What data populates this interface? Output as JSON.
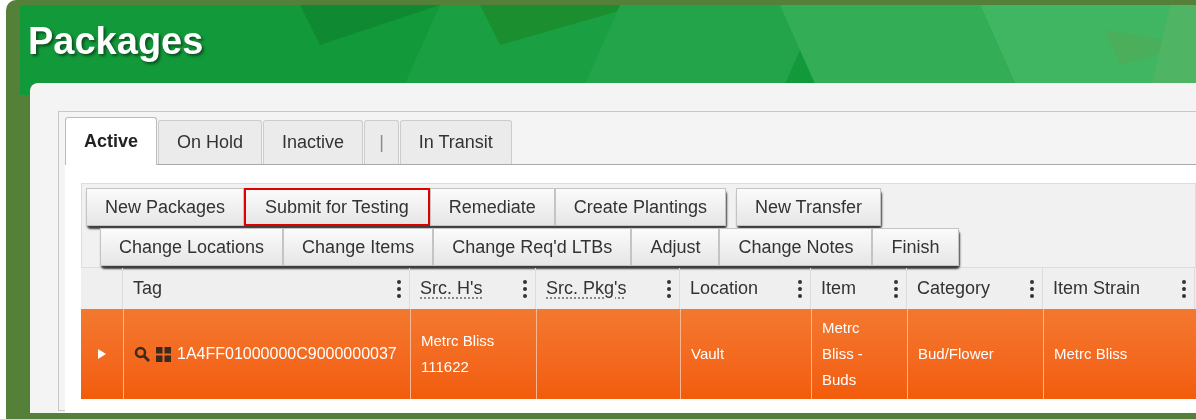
{
  "page": {
    "title": "Packages"
  },
  "tabs": [
    {
      "label": "Active",
      "kind": "tab",
      "selected": true
    },
    {
      "label": "On Hold",
      "kind": "tab",
      "selected": false
    },
    {
      "label": "Inactive",
      "kind": "tab",
      "selected": false
    },
    {
      "label": "|",
      "kind": "separator",
      "selected": false
    },
    {
      "label": "In Transit",
      "kind": "tab",
      "selected": false
    }
  ],
  "toolbar": {
    "rows": [
      {
        "groups": [
          [
            {
              "label": "New Packages",
              "highlighted": false
            },
            {
              "label": "Submit for Testing",
              "highlighted": true
            },
            {
              "label": "Remediate",
              "highlighted": false
            },
            {
              "label": "Create Plantings",
              "highlighted": false
            }
          ],
          [
            {
              "label": "New Transfer",
              "highlighted": false
            }
          ]
        ]
      },
      {
        "groups": [
          [
            {
              "label": "Change Locations",
              "highlighted": false
            },
            {
              "label": "Change Items",
              "highlighted": false
            },
            {
              "label": "Change Req'd LTBs",
              "highlighted": false
            },
            {
              "label": "Adjust",
              "highlighted": false
            },
            {
              "label": "Change Notes",
              "highlighted": false
            },
            {
              "label": "Finish",
              "highlighted": false
            }
          ]
        ]
      }
    ]
  },
  "table": {
    "columns": [
      {
        "label": "Tag",
        "abbr": false
      },
      {
        "label": "Src. H's",
        "abbr": true
      },
      {
        "label": "Src. Pkg's",
        "abbr": true
      },
      {
        "label": "Location",
        "abbr": false
      },
      {
        "label": "Item",
        "abbr": false
      },
      {
        "label": "Category",
        "abbr": false
      },
      {
        "label": "Item Strain",
        "abbr": false
      }
    ],
    "rows": [
      {
        "selected": true,
        "expanded": false,
        "cells": [
          "1A4FF01000000C9000000037",
          "Metrc Bliss 111622",
          "",
          "Vault",
          "Metrc Bliss - Buds",
          "Bud/Flower",
          "Metrc Bliss"
        ]
      }
    ]
  }
}
